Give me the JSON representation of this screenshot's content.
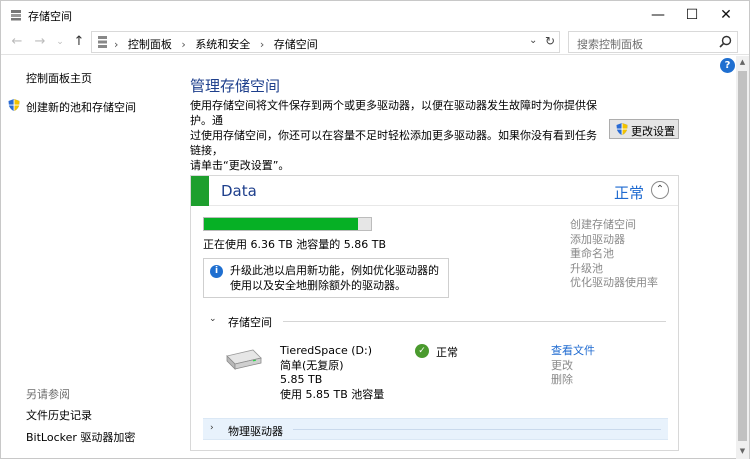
{
  "window": {
    "title": "存储空间"
  },
  "address": {
    "crumbs": [
      "控制面板",
      "系统和安全",
      "存储空间"
    ],
    "search_placeholder": "搜索控制面板"
  },
  "sidebar": {
    "home": "控制面板主页",
    "create_pool": "创建新的池和存储空间",
    "see_also": "另请参阅",
    "file_history": "文件历史记录",
    "bitlocker": "BitLocker 驱动器加密"
  },
  "main": {
    "heading": "管理存储空间",
    "desc_line1": "使用存储空间将文件保存到两个或更多驱动器，以便在驱动器发生故障时为你提供保护。通",
    "desc_line2": "过使用存储空间，你还可以在容量不足时轻松添加更多驱动器。如果你没有看到任务链接，",
    "desc_line3": "请单击“更改设置”。",
    "change_settings": "更改设置"
  },
  "pool": {
    "name": "Data",
    "status": "正常",
    "usage_fraction": 0.92,
    "usage_text": "正在使用 6.36 TB 池容量的 5.86 TB",
    "info_text": "升级此池以启用新功能，例如优化驱动器的使用以及安全地删除额外的驱动器。",
    "links": [
      "创建存储空间",
      "添加驱动器",
      "重命名池",
      "升级池",
      "优化驱动器使用率"
    ],
    "spaces_label": "存储空间",
    "space": {
      "name": "TieredSpace (D:)",
      "resiliency": "简单(无复原)",
      "size": "5.85 TB",
      "used": "使用 5.85 TB 池容量",
      "status": "正常",
      "view_files": "查看文件",
      "change": "更改",
      "delete": "删除"
    },
    "physical_label": "物理驱动器"
  },
  "colors": {
    "accent": "#1e3f8c",
    "link": "#1e6ad0",
    "green": "#06b025"
  }
}
